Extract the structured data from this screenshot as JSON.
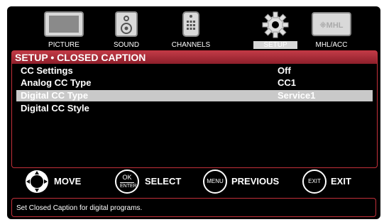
{
  "tabs": [
    {
      "label": "PICTURE",
      "icon": "monitor-icon"
    },
    {
      "label": "SOUND",
      "icon": "speaker-icon"
    },
    {
      "label": "CHANNELS",
      "icon": "remote-icon"
    },
    {
      "label": "SETUP",
      "icon": "gear-icon",
      "active": true
    },
    {
      "label": "MHL/ACC",
      "icon": "mhl-logo-icon",
      "logo_text": "MHL"
    }
  ],
  "panel": {
    "title": "SETUP • CLOSED CAPTION",
    "rows": [
      {
        "name": "CC Settings",
        "value": "Off"
      },
      {
        "name": "Analog CC Type",
        "value": "CC1"
      },
      {
        "name": "Digital CC Type",
        "value": "Service1",
        "selected": true
      },
      {
        "name": "Digital CC Style",
        "value": ""
      }
    ]
  },
  "hints": [
    {
      "key": "",
      "label": "MOVE",
      "icon": "dpad-icon"
    },
    {
      "key": "OK ENTER",
      "key_top": "OK",
      "key_bottom": "ENTER",
      "label": "SELECT"
    },
    {
      "key": "MENU",
      "label": "PREVIOUS"
    },
    {
      "key": "EXIT",
      "label": "EXIT"
    }
  ],
  "status_text": "Set Closed Caption for digital programs.",
  "colors": {
    "accent": "#c13a46",
    "selected_row": "#c9c9c9",
    "background": "#000000"
  }
}
